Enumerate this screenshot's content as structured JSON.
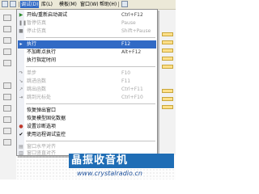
{
  "menubar": {
    "items": [
      {
        "label": "调试(D)",
        "active": true
      },
      {
        "label": "库(L)"
      },
      {
        "label": "模板(M)"
      },
      {
        "label": "窗口(W)"
      },
      {
        "label": "帮助(H)"
      }
    ]
  },
  "menu": {
    "items": [
      {
        "id": "start",
        "label": "开始/重新启动调试",
        "shortcut": "Ctrl+F12",
        "icon": "play-icon",
        "enabled": true
      },
      {
        "id": "pause",
        "label": "暂停仿真",
        "shortcut": "Pause",
        "icon": "pause-icon",
        "enabled": false
      },
      {
        "id": "stop",
        "label": "停止仿真",
        "shortcut": "Shift+Pause",
        "icon": "stop-icon",
        "enabled": false
      },
      {
        "id": "run",
        "label": "执行",
        "shortcut": "F12",
        "icon": "run-icon",
        "enabled": true,
        "highlighted": true
      },
      {
        "id": "run-no-bp",
        "label": "不加断点执行",
        "shortcut": "Alt+F12",
        "icon": "",
        "enabled": true
      },
      {
        "id": "run-for-time",
        "label": "执行指定时间",
        "shortcut": "",
        "icon": "",
        "enabled": true
      },
      {
        "id": "step",
        "label": "单步",
        "shortcut": "F10",
        "icon": "step-icon",
        "enabled": false
      },
      {
        "id": "step-in",
        "label": "跳进函数",
        "shortcut": "F11",
        "icon": "step-into-icon",
        "enabled": false
      },
      {
        "id": "step-out",
        "label": "跳出函数",
        "shortcut": "Ctrl+F11",
        "icon": "step-out-icon",
        "enabled": false
      },
      {
        "id": "run-to",
        "label": "跳到光标处",
        "shortcut": "Ctrl+F10",
        "icon": "run-to-cursor-icon",
        "enabled": false
      },
      {
        "id": "restore-popups",
        "label": "恢复弹出窗口",
        "shortcut": "",
        "icon": "",
        "enabled": true
      },
      {
        "id": "restore-model",
        "label": "恢复模型固化数据",
        "shortcut": "",
        "icon": "",
        "enabled": true
      },
      {
        "id": "diag",
        "label": "设置诊断选项",
        "shortcut": "",
        "icon": "diagnostic-icon",
        "enabled": true
      },
      {
        "id": "remote",
        "label": "使用远程调试监控",
        "shortcut": "",
        "icon": "",
        "enabled": true,
        "checked": true
      },
      {
        "id": "tile-h",
        "label": "窗口水平对齐",
        "shortcut": "",
        "icon": "tile-horizontal-icon",
        "enabled": false
      },
      {
        "id": "tile-v",
        "label": "窗口竖直对齐",
        "shortcut": "",
        "icon": "tile-vertical-icon",
        "enabled": false
      }
    ]
  },
  "watermark": {
    "logo_text": "晶振收音机",
    "site": "www.crystalradio.cn"
  },
  "colors": {
    "highlight": "#316ac5",
    "disabled_text": "#a6a6a6"
  }
}
